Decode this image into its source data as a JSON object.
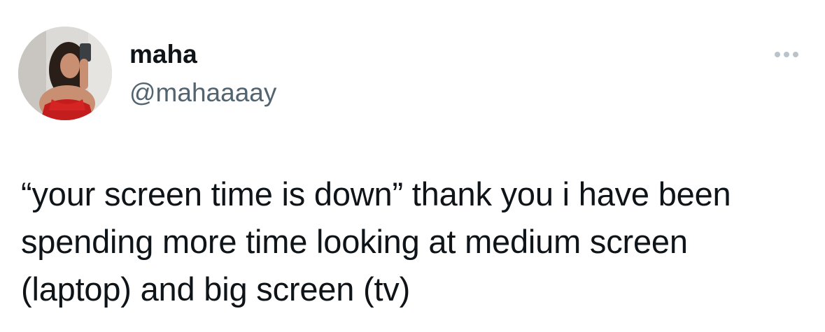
{
  "author": {
    "display_name": "maha",
    "handle": "@mahaaaay",
    "avatar_icon": "profile-photo"
  },
  "menu": {
    "icon": "more-horizontal-icon"
  },
  "tweet": {
    "lines": [
      "“your screen time is down” thank you i have been",
      "spending more time looking at medium screen",
      "(laptop) and big screen (tv)"
    ]
  },
  "colors": {
    "text_primary": "#0f1419",
    "text_secondary": "#536471",
    "menu_dots": "#b9c3cb",
    "background": "#ffffff"
  }
}
